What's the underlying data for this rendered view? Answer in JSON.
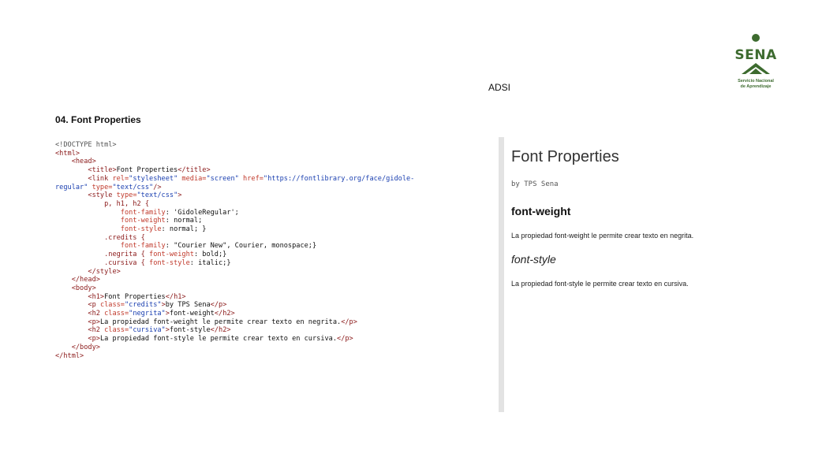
{
  "logo": {
    "name": "SENA",
    "subtitle_line1": "Servicio Nacional",
    "subtitle_line2": "de Aprendizaje"
  },
  "header": {
    "adsi": "ADSI"
  },
  "title": "04. Font Properties",
  "code_lines": {
    "l1": "<!DOCTYPE html>",
    "l2": "<html>",
    "l3": "<head>",
    "l4a": "<title>",
    "l4b": "Font Properties",
    "l4c": "</title>",
    "l5a": "<link ",
    "l5b": "rel=",
    "l5c": "\"stylesheet\"",
    "l5d": " media=",
    "l5e": "\"screen\"",
    "l5f": " href=",
    "l5g": "\"https://fontlibrary.org/face/gidole-",
    "l6a": "regular\"",
    "l6b": " type=",
    "l6c": "\"text/css\"",
    "l6d": "/>",
    "l7a": "<style ",
    "l7b": "type=",
    "l7c": "\"text/css\"",
    "l7d": ">",
    "l8": "p, h1, h2 {",
    "l9a": "font-family",
    "l9b": ": 'GidoleRegular';",
    "l10a": "font-weight",
    "l10b": ": normal;",
    "l11a": "font-style",
    "l11b": ": normal; }",
    "l12": ".credits {",
    "l13a": "font-family",
    "l13b": ": \"Courier New\", Courier, monospace;}",
    "l14a": ".negrita { ",
    "l14b": "font-weight",
    "l14c": ": bold;}",
    "l15a": ".cursiva { ",
    "l15b": "font-style",
    "l15c": ": italic;}",
    "l16": "</style>",
    "l17": "</head>",
    "l18": "<body>",
    "l19a": "<h1>",
    "l19b": "Font Properties",
    "l19c": "</h1>",
    "l20a": "<p ",
    "l20b": "class=",
    "l20c": "\"credits\"",
    "l20d": ">",
    "l20e": "by TPS Sena",
    "l20f": "</p>",
    "l21a": "<h2 ",
    "l21b": "class=",
    "l21c": "\"negrita\"",
    "l21d": ">",
    "l21e": "font-weight",
    "l21f": "</h2>",
    "l22a": "<p>",
    "l22b": "La propiedad font-weight le permite crear texto en negrita.",
    "l22c": "</p>",
    "l23a": "<h2 ",
    "l23b": "class=",
    "l23c": "\"cursiva\"",
    "l23d": ">",
    "l23e": "font-style",
    "l23f": "</h2>",
    "l24a": "<p>",
    "l24b": "La propiedad font-style le permite crear texto en cursiva.",
    "l24c": "</p>",
    "l25": "</body>",
    "l26": "</html>"
  },
  "preview": {
    "h1": "Font Properties",
    "credits": "by TPS Sena",
    "h2_bold": "font-weight",
    "p1": "La propiedad font-weight le permite crear texto en negrita.",
    "h2_italic": "font-style",
    "p2": "La propiedad font-style le permite crear texto en cursiva."
  }
}
